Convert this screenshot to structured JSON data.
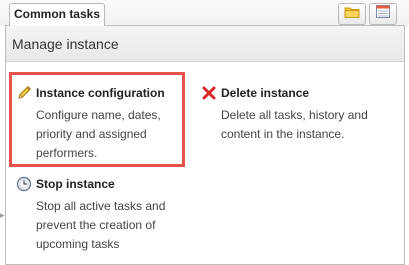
{
  "tabs": {
    "active_label": "Common tasks"
  },
  "toolbar": {
    "folder_icon": "folder-icon",
    "calendar_icon": "calendar-icon"
  },
  "panel": {
    "title": "Manage instance"
  },
  "tasks": [
    {
      "icon": "pencil-icon",
      "title": "Instance configuration",
      "description": [
        "Configure name, dates,",
        "priority and assigned",
        "performers."
      ]
    },
    {
      "icon": "delete-x-icon",
      "title": "Delete instance",
      "description": [
        "Delete all tasks, history and",
        "content in the instance."
      ]
    },
    {
      "icon": "stop-clock-icon",
      "title": "Stop instance",
      "description": [
        "Stop all active tasks and",
        "prevent the creation of",
        "upcoming tasks"
      ]
    }
  ],
  "colors": {
    "highlight": "#e8524a",
    "delete_icon": "#d9262a"
  }
}
